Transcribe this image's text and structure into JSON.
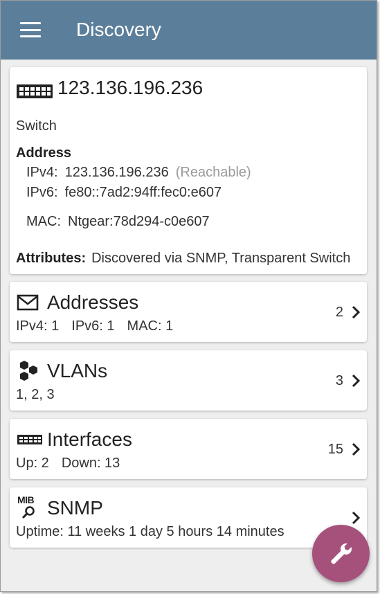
{
  "appbar": {
    "title": "Discovery",
    "menu_icon": "hamburger-menu-icon"
  },
  "device": {
    "icon": "switch-icon",
    "ip": "123.136.196.236",
    "type": "Switch",
    "address_heading": "Address",
    "ipv4_label": "IPv4:",
    "ipv4_value": "123.136.196.236",
    "ipv4_status": "(Reachable)",
    "ipv6_label": "IPv6:",
    "ipv6_value": "fe80::7ad2:94ff:fec0:e607",
    "mac_label": "MAC:",
    "mac_value": "Ntgear:78d294-c0e607",
    "attributes_label": "Attributes:",
    "attributes_value": "Discovered via SNMP, Transparent Switch"
  },
  "cards": {
    "addresses": {
      "icon": "envelope-icon",
      "title": "Addresses",
      "ipv4": "IPv4:  1",
      "ipv6": "IPv6:  1",
      "mac": "MAC:  1",
      "count": "2"
    },
    "vlans": {
      "icon": "hexagons-icon",
      "title": "VLANs",
      "subtitle": "1, 2, 3",
      "count": "3"
    },
    "interfaces": {
      "icon": "switch-icon",
      "title": "Interfaces",
      "up": "Up: 2",
      "down": "Down: 13",
      "count": "15"
    },
    "snmp": {
      "icon": "mib-search-icon",
      "icon_text": "MIB",
      "title": "SNMP",
      "subtitle": "Uptime:  11 weeks 1 day 5 hours 14 minutes"
    }
  },
  "fab": {
    "icon": "wrench-icon"
  },
  "colors": {
    "appbar": "#5b7f9b",
    "fab": "#a6507c",
    "background": "#eeeeee"
  }
}
